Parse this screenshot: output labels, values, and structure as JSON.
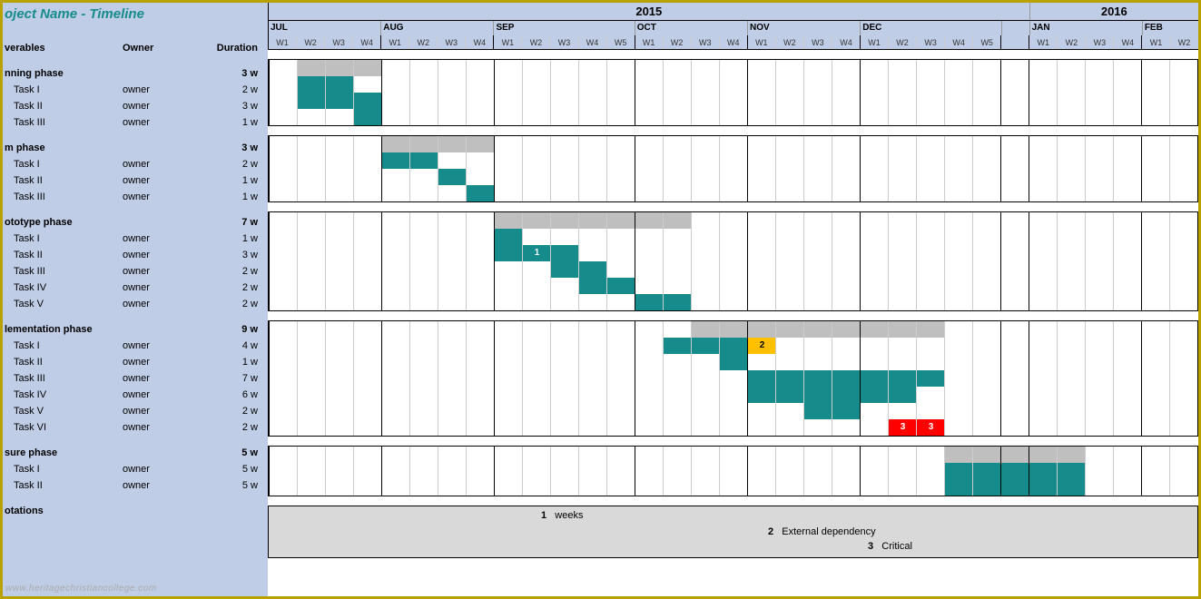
{
  "title": "oject Name - Timeline",
  "headers": {
    "deliverables": "verables",
    "owner": "Owner",
    "duration": "Duration"
  },
  "owner_default": "owner",
  "years": [
    {
      "label": "2015",
      "weeks": 27
    },
    {
      "label": "2016",
      "weeks": 6
    }
  ],
  "months": [
    {
      "label": "JUL",
      "weeks": 4,
      "startWeekIdx": 0
    },
    {
      "label": "AUG",
      "weeks": 4,
      "startWeekIdx": 4
    },
    {
      "label": "SEP",
      "weeks": 5,
      "startWeekIdx": 8
    },
    {
      "label": "OCT",
      "weeks": 4,
      "startWeekIdx": 13
    },
    {
      "label": "NOV",
      "weeks": 4,
      "startWeekIdx": 17
    },
    {
      "label": "DEC",
      "weeks": 5,
      "startWeekIdx": 21
    },
    {
      "label": "",
      "weeks": 1,
      "startWeekIdx": 26
    },
    {
      "label": "JAN",
      "weeks": 4,
      "startWeekIdx": 27
    },
    {
      "label": "FEB",
      "weeks": 2,
      "startWeekIdx": 31
    }
  ],
  "week_labels": [
    "W1",
    "W2",
    "W3",
    "W4",
    "W1",
    "W2",
    "W3",
    "W4",
    "W1",
    "W2",
    "W3",
    "W4",
    "W5",
    "W1",
    "W2",
    "W3",
    "W4",
    "W1",
    "W2",
    "W3",
    "W4",
    "W1",
    "W2",
    "W3",
    "W4",
    "W5",
    "",
    "W1",
    "W2",
    "W3",
    "W4",
    "W1",
    "W2"
  ],
  "total_weeks": 33,
  "month_starts": [
    0,
    4,
    8,
    13,
    17,
    21,
    26,
    27,
    31
  ],
  "phases": [
    {
      "name": "nning phase",
      "duration": "3 w",
      "summary": {
        "start": 1,
        "len": 3
      },
      "tasks": [
        {
          "name": "Task I",
          "owner": "owner",
          "duration": "2 w",
          "bars": [
            {
              "start": 1,
              "len": 2,
              "type": "task"
            }
          ]
        },
        {
          "name": "Task II",
          "owner": "owner",
          "duration": "3 w",
          "bars": [
            {
              "start": 1,
              "len": 3,
              "type": "task"
            }
          ]
        },
        {
          "name": "Task III",
          "owner": "owner",
          "duration": "1 w",
          "bars": [
            {
              "start": 3,
              "len": 1,
              "type": "task"
            }
          ]
        }
      ]
    },
    {
      "name": "m phase",
      "duration": "3 w",
      "summary": {
        "start": 4,
        "len": 4
      },
      "tasks": [
        {
          "name": "Task I",
          "owner": "owner",
          "duration": "2 w",
          "bars": [
            {
              "start": 4,
              "len": 2,
              "type": "task"
            }
          ]
        },
        {
          "name": "Task II",
          "owner": "owner",
          "duration": "1 w",
          "bars": [
            {
              "start": 6,
              "len": 1,
              "type": "task"
            }
          ]
        },
        {
          "name": "Task III",
          "owner": "owner",
          "duration": "1 w",
          "bars": [
            {
              "start": 7,
              "len": 1,
              "type": "task"
            }
          ]
        }
      ]
    },
    {
      "name": "ototype phase",
      "duration": "7 w",
      "summary": {
        "start": 8,
        "len": 7
      },
      "tasks": [
        {
          "name": "Task I",
          "owner": "owner",
          "duration": "1 w",
          "bars": [
            {
              "start": 8,
              "len": 1,
              "type": "task"
            }
          ]
        },
        {
          "name": "Task II",
          "owner": "owner",
          "duration": "3 w",
          "bars": [
            {
              "start": 8,
              "len": 3,
              "type": "task",
              "label": "1"
            }
          ]
        },
        {
          "name": "Task III",
          "owner": "owner",
          "duration": "2 w",
          "bars": [
            {
              "start": 10,
              "len": 2,
              "type": "task"
            }
          ]
        },
        {
          "name": "Task IV",
          "owner": "owner",
          "duration": "2 w",
          "bars": [
            {
              "start": 11,
              "len": 2,
              "type": "task"
            }
          ]
        },
        {
          "name": "Task V",
          "owner": "owner",
          "duration": "2 w",
          "bars": [
            {
              "start": 13,
              "len": 2,
              "type": "task"
            }
          ]
        }
      ]
    },
    {
      "name": "lementation phase",
      "duration": "9 w",
      "summary": {
        "start": 15,
        "len": 9
      },
      "tasks": [
        {
          "name": "Task I",
          "owner": "owner",
          "duration": "4 w",
          "bars": [
            {
              "start": 14,
              "len": 3,
              "type": "task"
            },
            {
              "start": 17,
              "len": 1,
              "type": "ext",
              "label": "2"
            }
          ]
        },
        {
          "name": "Task II",
          "owner": "owner",
          "duration": "1 w",
          "bars": [
            {
              "start": 16,
              "len": 1,
              "type": "task"
            }
          ]
        },
        {
          "name": "Task III",
          "owner": "owner",
          "duration": "7 w",
          "bars": [
            {
              "start": 17,
              "len": 7,
              "type": "task"
            }
          ]
        },
        {
          "name": "Task IV",
          "owner": "owner",
          "duration": "6 w",
          "bars": [
            {
              "start": 17,
              "len": 6,
              "type": "task"
            }
          ]
        },
        {
          "name": "Task V",
          "owner": "owner",
          "duration": "2 w",
          "bars": [
            {
              "start": 19,
              "len": 2,
              "type": "task"
            }
          ]
        },
        {
          "name": "Task VI",
          "owner": "owner",
          "duration": "2 w",
          "bars": [
            {
              "start": 22,
              "len": 1,
              "type": "crit",
              "label": "3"
            },
            {
              "start": 23,
              "len": 1,
              "type": "crit",
              "label": "3"
            }
          ]
        }
      ]
    },
    {
      "name": "sure phase",
      "duration": "5 w",
      "summary": {
        "start": 24,
        "len": 5
      },
      "tasks": [
        {
          "name": "Task I",
          "owner": "owner",
          "duration": "5 w",
          "bars": [
            {
              "start": 24,
              "len": 5,
              "type": "task"
            }
          ]
        },
        {
          "name": "Task II",
          "owner": "owner",
          "duration": "5 w",
          "bars": [
            {
              "start": 24,
              "len": 5,
              "type": "task"
            }
          ]
        }
      ]
    }
  ],
  "annotations_label": "otations",
  "legend": [
    {
      "n": "1",
      "text": "weeks"
    },
    {
      "n": "2",
      "text": "External dependency"
    },
    {
      "n": "3",
      "text": "Critical"
    }
  ],
  "watermark": "www.heritagechristiancollege.com",
  "chart_data": {
    "type": "gantt",
    "time_unit": "week",
    "start": "2015-07-W1",
    "columns": 33,
    "axis_weeks": [
      "2015-JUL-W1",
      "W2",
      "W3",
      "W4",
      "2015-AUG-W1",
      "W2",
      "W3",
      "W4",
      "2015-SEP-W1",
      "W2",
      "W3",
      "W4",
      "W5",
      "2015-OCT-W1",
      "W2",
      "W3",
      "W4",
      "2015-NOV-W1",
      "W2",
      "W3",
      "W4",
      "2015-DEC-W1",
      "W2",
      "W3",
      "W4",
      "W5",
      "gap",
      "2016-JAN-W1",
      "W2",
      "W3",
      "W4",
      "2016-FEB-W1",
      "W2"
    ],
    "series": [
      {
        "phase": "Planning phase",
        "duration_w": 3,
        "summary_start": 1,
        "summary_end": 3,
        "tasks": [
          {
            "name": "Task I",
            "owner": "owner",
            "start": 1,
            "end": 2
          },
          {
            "name": "Task II",
            "owner": "owner",
            "start": 1,
            "end": 3
          },
          {
            "name": "Task III",
            "owner": "owner",
            "start": 3,
            "end": 3
          }
        ]
      },
      {
        "phase": "? phase",
        "duration_w": 3,
        "summary_start": 4,
        "summary_end": 7,
        "tasks": [
          {
            "name": "Task I",
            "owner": "owner",
            "start": 4,
            "end": 5
          },
          {
            "name": "Task II",
            "owner": "owner",
            "start": 6,
            "end": 6
          },
          {
            "name": "Task III",
            "owner": "owner",
            "start": 7,
            "end": 7
          }
        ]
      },
      {
        "phase": "Prototype phase",
        "duration_w": 7,
        "summary_start": 8,
        "summary_end": 14,
        "tasks": [
          {
            "name": "Task I",
            "owner": "owner",
            "start": 8,
            "end": 8
          },
          {
            "name": "Task II",
            "owner": "owner",
            "start": 8,
            "end": 10,
            "note": "1"
          },
          {
            "name": "Task III",
            "owner": "owner",
            "start": 10,
            "end": 11
          },
          {
            "name": "Task IV",
            "owner": "owner",
            "start": 11,
            "end": 12
          },
          {
            "name": "Task V",
            "owner": "owner",
            "start": 13,
            "end": 14
          }
        ]
      },
      {
        "phase": "Implementation phase",
        "duration_w": 9,
        "summary_start": 15,
        "summary_end": 23,
        "tasks": [
          {
            "name": "Task I",
            "owner": "owner",
            "start": 14,
            "end": 17,
            "note": "2 external dep at W17"
          },
          {
            "name": "Task II",
            "owner": "owner",
            "start": 16,
            "end": 16
          },
          {
            "name": "Task III",
            "owner": "owner",
            "start": 17,
            "end": 23
          },
          {
            "name": "Task IV",
            "owner": "owner",
            "start": 17,
            "end": 22
          },
          {
            "name": "Task V",
            "owner": "owner",
            "start": 19,
            "end": 20
          },
          {
            "name": "Task VI",
            "owner": "owner",
            "start": 22,
            "end": 23,
            "note": "3 critical"
          }
        ]
      },
      {
        "phase": "Closure phase",
        "duration_w": 5,
        "summary_start": 24,
        "summary_end": 28,
        "tasks": [
          {
            "name": "Task I",
            "owner": "owner",
            "start": 24,
            "end": 28
          },
          {
            "name": "Task II",
            "owner": "owner",
            "start": 24,
            "end": 28
          }
        ]
      }
    ],
    "legend": {
      "1": "weeks",
      "2": "External dependency",
      "3": "Critical"
    },
    "colors": {
      "summary": "#bfbfbf",
      "task": "#158b8c",
      "external": "#ffc000",
      "critical": "#ff0000"
    }
  }
}
